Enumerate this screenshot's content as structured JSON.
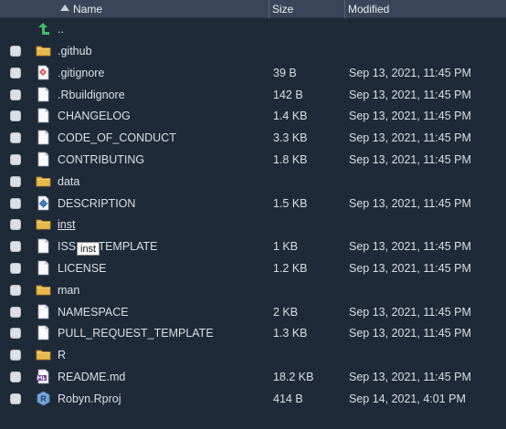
{
  "header": {
    "name_label": "Name",
    "size_label": "Size",
    "modified_label": "Modified"
  },
  "parent_row": {
    "label": ".."
  },
  "files": [
    {
      "name": ".github",
      "type": "folder",
      "size": "",
      "modified": ""
    },
    {
      "name": ".gitignore",
      "type": "git-file",
      "size": "39 B",
      "modified": "Sep 13, 2021, 11:45 PM"
    },
    {
      "name": ".Rbuildignore",
      "type": "file",
      "size": "142 B",
      "modified": "Sep 13, 2021, 11:45 PM"
    },
    {
      "name": "CHANGELOG",
      "type": "file",
      "size": "1.4 KB",
      "modified": "Sep 13, 2021, 11:45 PM"
    },
    {
      "name": "CODE_OF_CONDUCT",
      "type": "file",
      "size": "3.3 KB",
      "modified": "Sep 13, 2021, 11:45 PM"
    },
    {
      "name": "CONTRIBUTING",
      "type": "file",
      "size": "1.8 KB",
      "modified": "Sep 13, 2021, 11:45 PM"
    },
    {
      "name": "data",
      "type": "folder",
      "size": "",
      "modified": ""
    },
    {
      "name": "DESCRIPTION",
      "type": "description-file",
      "size": "1.5 KB",
      "modified": "Sep 13, 2021, 11:45 PM"
    },
    {
      "name": "inst",
      "type": "folder",
      "size": "",
      "modified": ""
    },
    {
      "name": "ISSUE_TEMPLATE",
      "type": "file",
      "size": "1 KB",
      "modified": "Sep 13, 2021, 11:45 PM"
    },
    {
      "name": "LICENSE",
      "type": "file",
      "size": "1.2 KB",
      "modified": "Sep 13, 2021, 11:45 PM"
    },
    {
      "name": "man",
      "type": "folder",
      "size": "",
      "modified": ""
    },
    {
      "name": "NAMESPACE",
      "type": "file",
      "size": "2 KB",
      "modified": "Sep 13, 2021, 11:45 PM"
    },
    {
      "name": "PULL_REQUEST_TEMPLATE",
      "type": "file",
      "size": "1.3 KB",
      "modified": "Sep 13, 2021, 11:45 PM"
    },
    {
      "name": "R",
      "type": "folder",
      "size": "",
      "modified": ""
    },
    {
      "name": "README.md",
      "type": "markdown-file",
      "size": "18.2 KB",
      "modified": "Sep 13, 2021, 11:45 PM"
    },
    {
      "name": "Robyn.Rproj",
      "type": "rproj-file",
      "size": "414 B",
      "modified": "Sep 14, 2021, 4:01 PM"
    }
  ],
  "tooltip": {
    "text": "inst"
  },
  "colors": {
    "background": "#1f2a38",
    "header": "#3a4658",
    "folder": "#e8b84a",
    "up_arrow": "#3fbf6a",
    "text": "#d9dfe6"
  }
}
